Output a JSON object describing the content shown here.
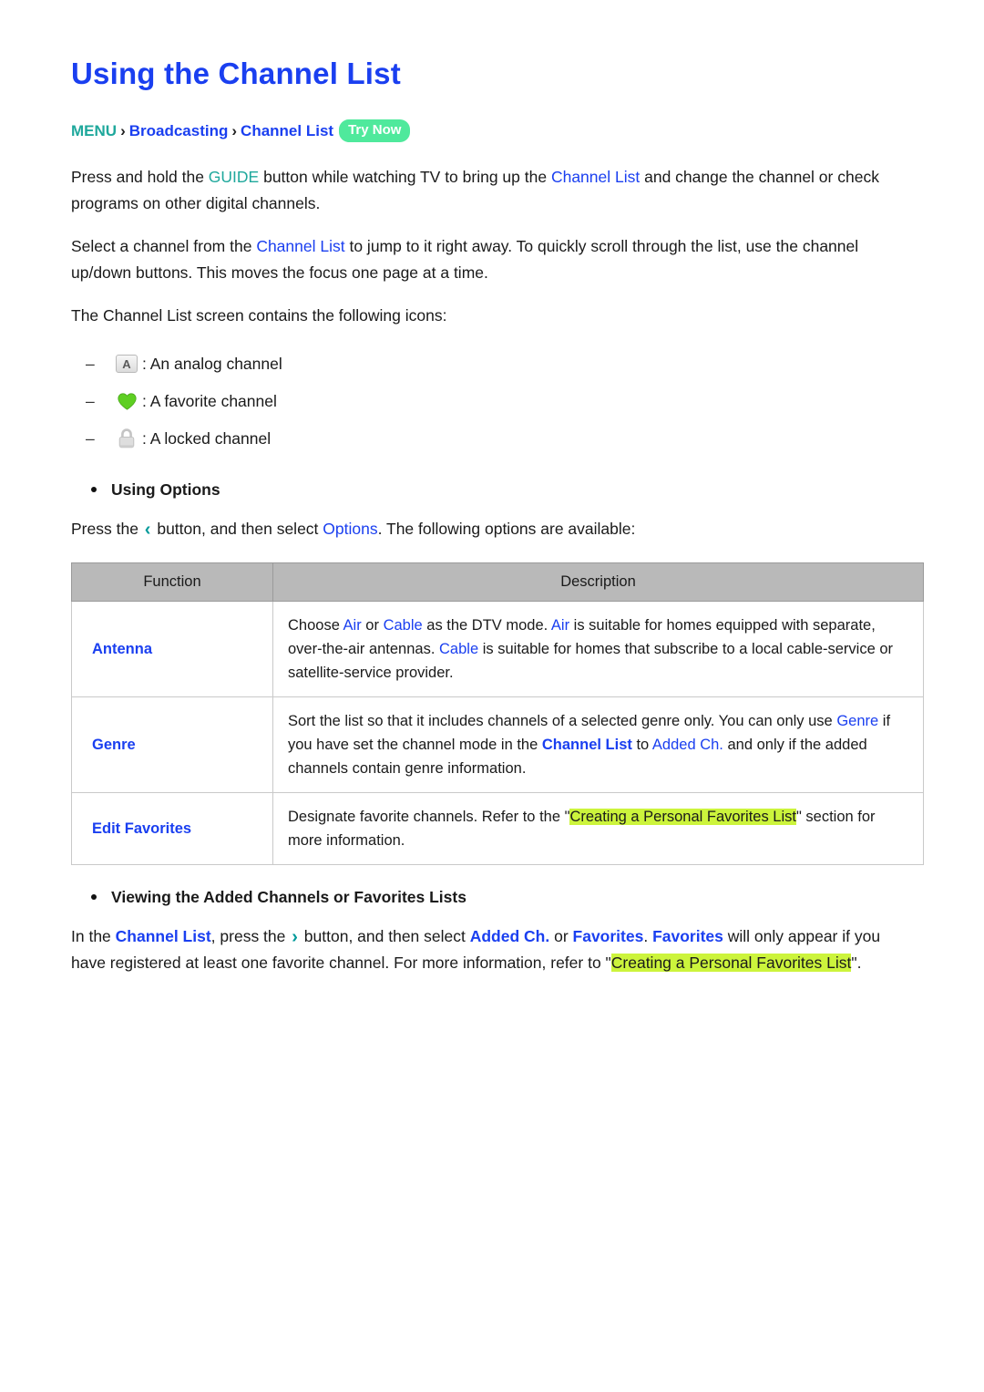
{
  "page": {
    "title": "Using the Channel List"
  },
  "breadcrumb": {
    "menu": "MENU",
    "sep": "›",
    "item1": "Broadcasting",
    "item2": "Channel List",
    "badge": "Try Now"
  },
  "paragraphs": {
    "p1": {
      "a": "Press and hold the ",
      "kw1": "GUIDE",
      "b": " button while watching TV to bring up the ",
      "kw2": "Channel List",
      "c": " and change the channel or check programs on other digital channels."
    },
    "p2": {
      "a": "Select a channel from the ",
      "kw1": "Channel List",
      "b": " to jump to it right away. To quickly scroll through the list, use the channel up/down buttons. This moves the focus one page at a time."
    },
    "p3": "The Channel List screen contains the following icons:"
  },
  "icon_list": [
    {
      "dash": "–",
      "icon": "analog-channel-icon",
      "icon_text": "A",
      "label": ": An analog channel"
    },
    {
      "dash": "–",
      "icon": "favorite-heart-icon",
      "icon_text": "",
      "label": ": A favorite channel"
    },
    {
      "dash": "–",
      "icon": "locked-padlock-icon",
      "icon_text": "",
      "label": ": A locked channel"
    }
  ],
  "using_options": {
    "heading": "Using Options",
    "intro": {
      "a": "Press the ",
      "chevron": "‹",
      "b": " button, and then select ",
      "kw1": "Options",
      "c": ". The following options are available:"
    },
    "table": {
      "headers": {
        "function": "Function",
        "description": "Description"
      },
      "rows": [
        {
          "function": "Antenna",
          "desc": {
            "t1": "Choose ",
            "k1": "Air",
            "t2": " or ",
            "k2": "Cable",
            "t3": " as the DTV mode. ",
            "k3": "Air",
            "t4": " is suitable for homes equipped with separate, over-the-air antennas. ",
            "k4": "Cable",
            "t5": " is suitable for homes that subscribe to a local cable-service or satellite-service provider."
          }
        },
        {
          "function": "Genre",
          "desc": {
            "t1": "Sort the list so that it includes channels of a selected genre only. You can only use ",
            "k1": "Genre",
            "t2": " if you have set the channel mode in the ",
            "k2": "Channel List",
            "t3": " to ",
            "k3": "Added Ch.",
            "t4": " and only if the added channels contain genre information.",
            "k4": "",
            "t5": ""
          }
        },
        {
          "function": "Edit Favorites",
          "desc": {
            "t1": "Designate favorite channels. Refer to the \"",
            "k1": "",
            "t2": "",
            "k2": "",
            "t3": "",
            "hl": "Creating a Personal Favorites List",
            "t4": "\" section for more information.",
            "k4": "",
            "t5": ""
          }
        }
      ]
    }
  },
  "viewing_lists": {
    "heading": "Viewing the Added Channels or Favorites Lists",
    "body": {
      "a": "In the ",
      "k1": "Channel List",
      "b": ", press the ",
      "chevron": "›",
      "c": " button, and then select ",
      "k2": "Added Ch.",
      "d": " or ",
      "k3": "Favorites",
      "e": ". ",
      "k4": "Favorites",
      "f": " will only appear if you have registered at least one favorite channel. For more information, refer to \"",
      "hl": "Creating a Personal Favorites List",
      "g": "\"."
    }
  },
  "colors": {
    "title_blue": "#1a3ff0",
    "keyword_blue": "#1a3ff0",
    "teal": "#1fa89c",
    "badge_green": "#4fe99c",
    "highlight": "#ccf43c",
    "heart_green": "#5ecf22",
    "table_header_gray": "#b9b9b9"
  }
}
